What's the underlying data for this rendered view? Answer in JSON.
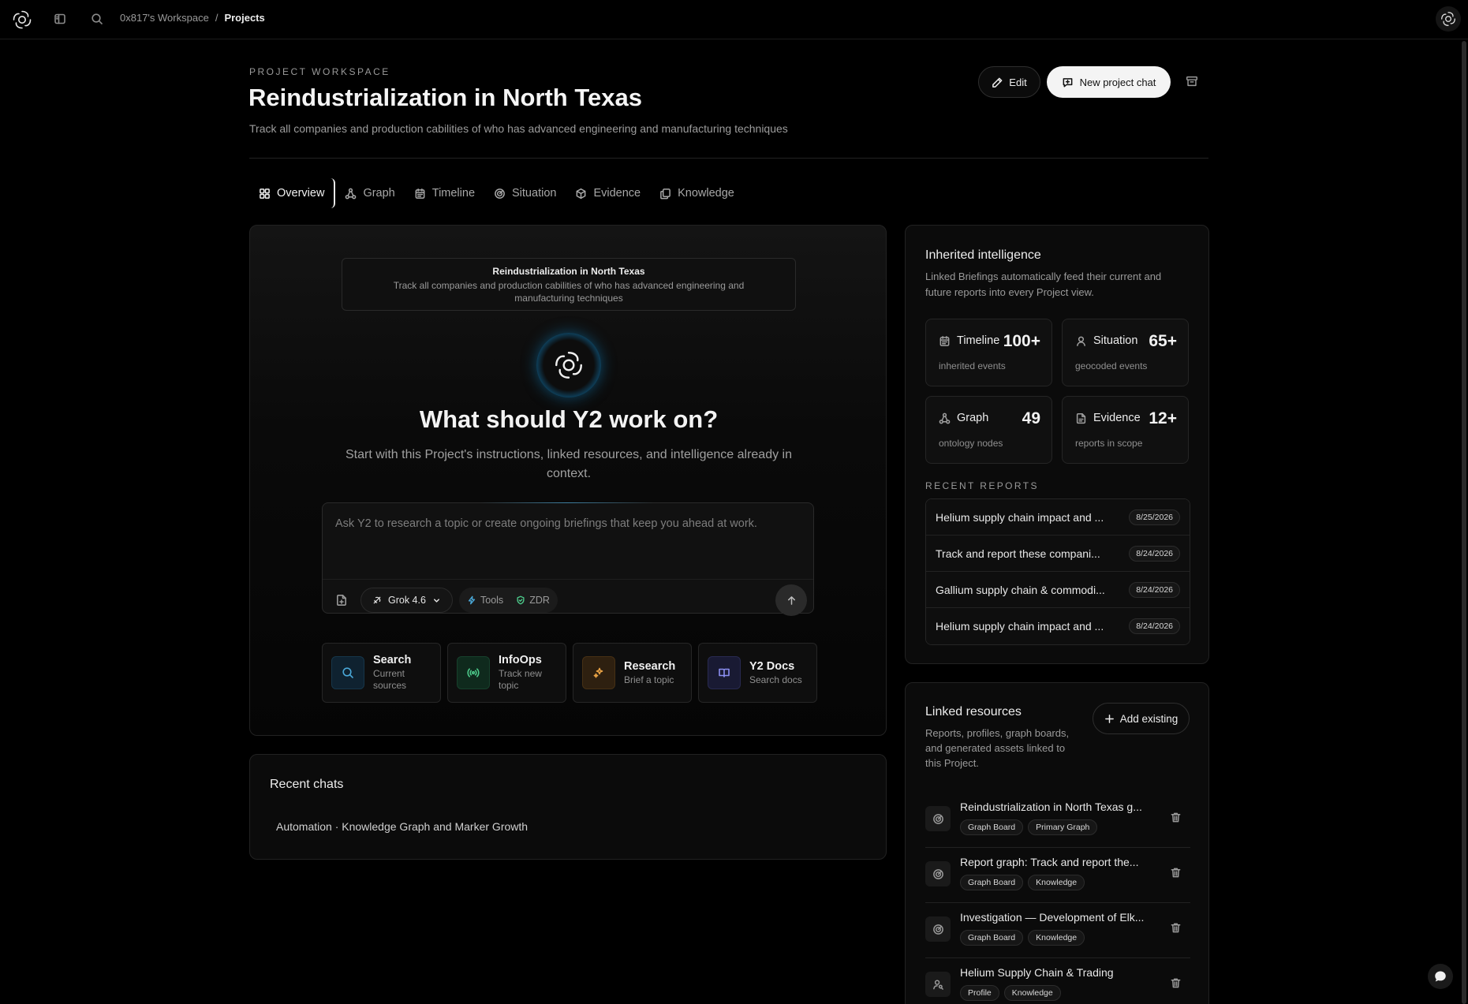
{
  "topbar": {
    "breadcrumb_workspace": "0x817's Workspace",
    "breadcrumb_sep": "/",
    "breadcrumb_current": "Projects"
  },
  "header": {
    "eyebrow": "PROJECT WORKSPACE",
    "title": "Reindustrialization in North Texas",
    "description": "Track all companies and production cabilities of who has advanced engineering and manufacturing techniques",
    "edit_label": "Edit",
    "new_chat_label": "New project chat"
  },
  "tabs": [
    {
      "label": "Overview",
      "icon": "grid-icon"
    },
    {
      "label": "Graph",
      "icon": "graph-icon"
    },
    {
      "label": "Timeline",
      "icon": "calendar-icon"
    },
    {
      "label": "Situation",
      "icon": "radar-icon"
    },
    {
      "label": "Evidence",
      "icon": "cube-icon"
    },
    {
      "label": "Knowledge",
      "icon": "copy-icon"
    }
  ],
  "main": {
    "context_title": "Reindustrialization in North Texas",
    "context_desc": "Track all companies and production cabilities of who has advanced engineering and manufacturing techniques",
    "hero_question": "What should Y2 work on?",
    "hero_sub": "Start with this Project's instructions, linked resources, and intelligence already in context.",
    "composer_placeholder": "Ask Y2 to research a topic or create ongoing briefings that keep you ahead at work.",
    "model": "Grok 4.6",
    "tools_label": "Tools",
    "zdr_label": "ZDR",
    "actions": [
      {
        "title": "Search",
        "sub": "Current sources",
        "icon": "search-icon",
        "color": "#4aa8d8",
        "bg": "#0f2230"
      },
      {
        "title": "InfoOps",
        "sub": "Track new topic",
        "icon": "broadcast-icon",
        "color": "#4cc98a",
        "bg": "#0f2a1d"
      },
      {
        "title": "Research",
        "sub": "Brief a topic",
        "icon": "sparkle-icon",
        "color": "#e8a245",
        "bg": "#2e2010"
      },
      {
        "title": "Y2 Docs",
        "sub": "Search docs",
        "icon": "book-icon",
        "color": "#8a8ef0",
        "bg": "#191a33"
      }
    ]
  },
  "recent_chats": {
    "title": "Recent chats",
    "items": [
      "Automation · Knowledge Graph and Marker Growth"
    ]
  },
  "inherited": {
    "title": "Inherited intelligence",
    "description": "Linked Briefings automatically feed their current and future reports into every Project view.",
    "stats": [
      {
        "label": "Timeline",
        "value": "100+",
        "sub": "inherited events",
        "icon": "calendar-icon"
      },
      {
        "label": "Situation",
        "value": "65+",
        "sub": "geocoded events",
        "icon": "person-pin-icon"
      },
      {
        "label": "Graph",
        "value": "49",
        "sub": "ontology nodes",
        "icon": "graph-icon"
      },
      {
        "label": "Evidence",
        "value": "12+",
        "sub": "reports in scope",
        "icon": "document-icon"
      }
    ],
    "recent_reports_label": "RECENT REPORTS",
    "recent_reports": [
      {
        "name": "Helium supply chain impact and ...",
        "date": "8/25/2026"
      },
      {
        "name": "Track and report these compani...",
        "date": "8/24/2026"
      },
      {
        "name": "Gallium supply chain & commodi...",
        "date": "8/24/2026"
      },
      {
        "name": "Helium supply chain impact and ...",
        "date": "8/24/2026"
      }
    ]
  },
  "linked": {
    "title": "Linked resources",
    "description": "Reports, profiles, graph boards, and generated assets linked to this Project.",
    "add_label": "Add existing",
    "items": [
      {
        "name": "Reindustrialization in North Texas g...",
        "tags": [
          "Graph Board",
          "Primary Graph"
        ],
        "icon": "radar-icon"
      },
      {
        "name": "Report graph: Track and report the...",
        "tags": [
          "Graph Board",
          "Knowledge"
        ],
        "icon": "radar-icon"
      },
      {
        "name": "Investigation — Development of Elk...",
        "tags": [
          "Graph Board",
          "Knowledge"
        ],
        "icon": "radar-icon"
      },
      {
        "name": "Helium Supply Chain & Trading",
        "tags": [
          "Profile",
          "Knowledge"
        ],
        "icon": "profile-search-icon"
      }
    ]
  }
}
